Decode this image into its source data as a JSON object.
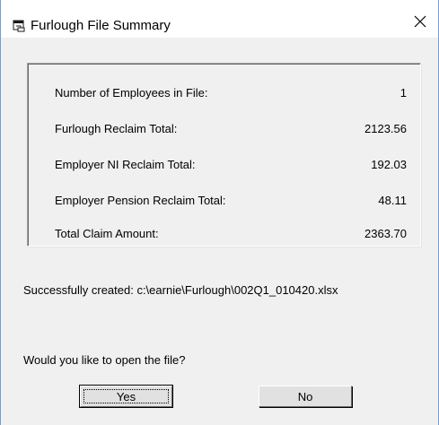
{
  "window": {
    "title": "Furlough File Summary",
    "icon": "app-window-icon",
    "close_icon": "close-icon"
  },
  "summary": {
    "rows": [
      {
        "label": "Number of Employees in File:",
        "value": "1"
      },
      {
        "label": "Furlough Reclaim Total:",
        "value": "2123.56"
      },
      {
        "label": "Employer NI Reclaim Total:",
        "value": "192.03"
      },
      {
        "label": "Employer Pension Reclaim Total:",
        "value": "48.11"
      },
      {
        "label": "Total Claim Amount:",
        "value": "2363.70"
      }
    ]
  },
  "status_message": "Successfully created: c:\\earnie\\Furlough\\002Q1_010420.xlsx",
  "prompt": {
    "question": "Would you like to open the file?",
    "yes_label": "Yes",
    "no_label": "No"
  },
  "colors": {
    "window_border": "#6f9fd6",
    "client_background": "#f0f0f0",
    "button_face": "#e1e1e1"
  }
}
